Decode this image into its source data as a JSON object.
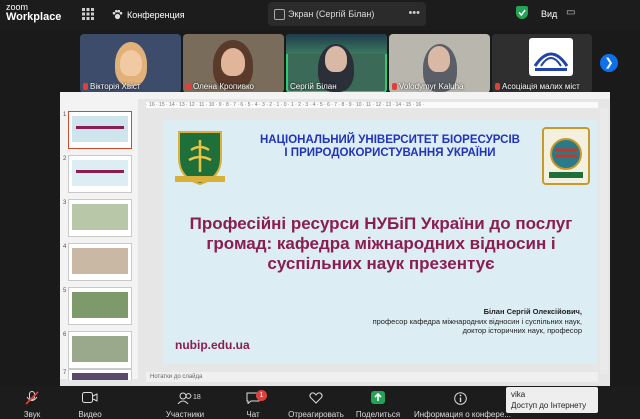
{
  "app": {
    "logo_line1": "zoom",
    "logo_line2": "Workplace"
  },
  "topbar": {
    "apps_icon": "grid-icon",
    "conference_label": "Конференция",
    "screen_title": "Экран (Сергій Білан)",
    "more_label": "•••",
    "view_label": "Вид",
    "shield_color": "#23a455"
  },
  "participants": [
    {
      "name": "Вікторія Хвіст",
      "muted": true
    },
    {
      "name": "Олена Кропивко",
      "muted": true
    },
    {
      "name": "Сергій Білан",
      "muted": false,
      "active": true
    },
    {
      "name": "Volodymyr Kaluha",
      "muted": true
    },
    {
      "name": "Асоціація малих міст",
      "muted": true
    }
  ],
  "powerpoint": {
    "ruler_text": "· 16 · 15 · 14 · 13 · 12 · 11 · 10 · 9 · 8 · 7 · 6 · 5 · 4 · 3 · 2 · 1 · 0 · 1 · 2 · 3 · 4 · 5 · 6 · 7 · 8 · 9 · 10 · 11 · 12 · 13 · 14 · 15 · 16 ·",
    "thumbnail_numbers": [
      "1",
      "2",
      "3",
      "4",
      "5",
      "6",
      "7"
    ],
    "notes_placeholder": "Нотатки до слайда"
  },
  "slide": {
    "university_line1": "НАЦІОНАЛЬНИЙ УНІВЕРСИТЕТ БІОРЕСУРСІВ",
    "university_line2": "І ПРИРОДОКОРИСТУВАННЯ УКРАЇНИ",
    "title": "Професійні ресурси НУБіП України до послуг громад: кафедра міжнародних відносин і суспільних наук презентує",
    "author_name": "Білан Сергій Олексійович,",
    "author_line2": "професор кафедра міжнародних відносин і суспільних наук,",
    "author_line3": "доктор історичних наук, професор",
    "website": "nubip.edu.ua",
    "title_color": "#8a1d52",
    "university_color": "#2233bb"
  },
  "toolbar": {
    "sound": "Звук",
    "video": "Видео",
    "participants": "Участники",
    "participants_count": "18",
    "chat": "Чат",
    "chat_badge": "1",
    "react": "Отреагировать",
    "share": "Поделиться",
    "info": "Информация о конфере..."
  },
  "tooltip": {
    "line1": "vika",
    "line2": "Доступ до Інтернету"
  }
}
